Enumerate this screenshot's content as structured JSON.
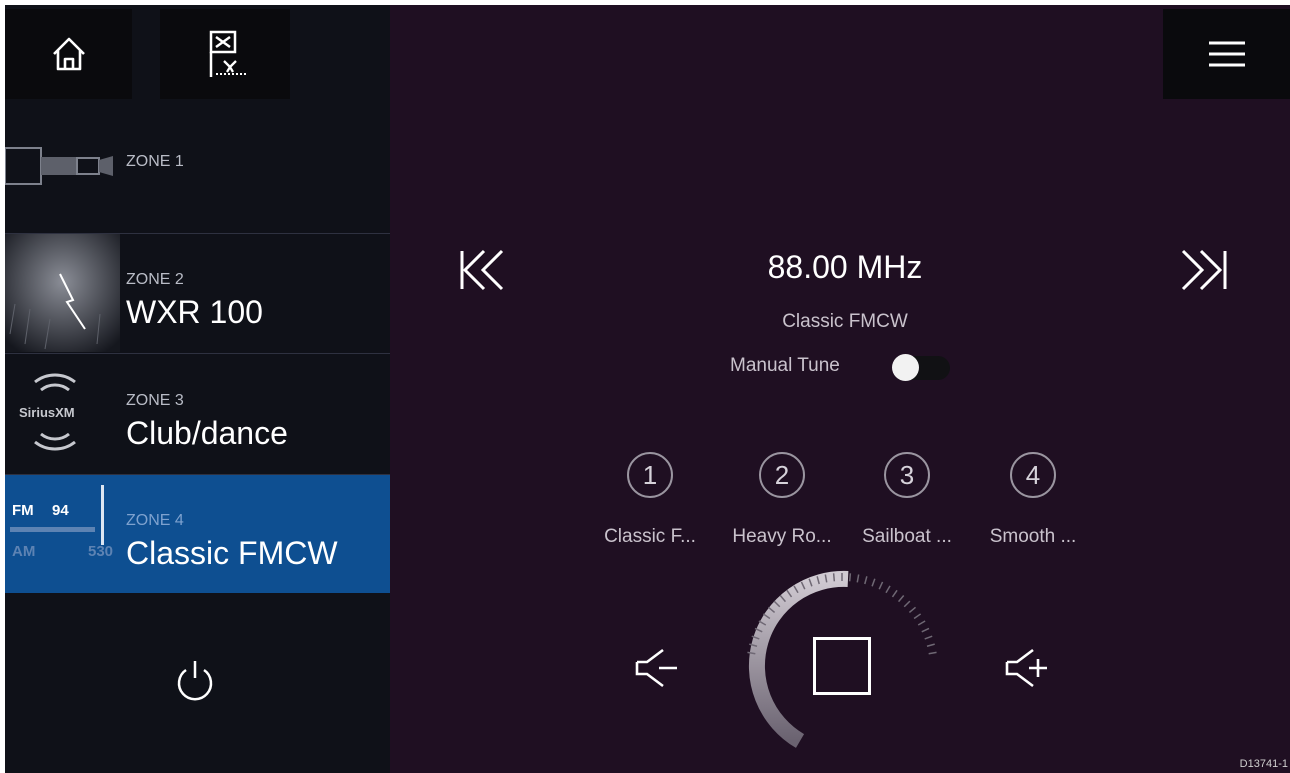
{
  "sidebar": {
    "zones": [
      {
        "label": "ZONE 1",
        "name": ""
      },
      {
        "label": "ZONE 2",
        "name": "WXR 100"
      },
      {
        "label": "ZONE 3",
        "name": "Club/dance"
      },
      {
        "label": "ZONE 4",
        "name": "Classic FMCW"
      }
    ],
    "sirius_logo_text": "SiriusXM",
    "radio_thumb": {
      "fm": "FM",
      "fm_value": "94",
      "am": "AM",
      "am_value": "530"
    }
  },
  "main": {
    "frequency": "88.00 MHz",
    "station": "Classic FMCW",
    "manual_tune_label": "Manual Tune",
    "manual_tune_on": false,
    "presets": [
      {
        "number": "1",
        "label": "Classic F..."
      },
      {
        "number": "2",
        "label": "Heavy Ro..."
      },
      {
        "number": "3",
        "label": "Sailboat ..."
      },
      {
        "number": "4",
        "label": "Smooth ..."
      }
    ],
    "volume_level": 0.5
  },
  "doc_id": "D13741-1",
  "colors": {
    "background": "#1f0f22",
    "sidebar": "#0f1118",
    "selected_zone": "#0e4f91"
  }
}
